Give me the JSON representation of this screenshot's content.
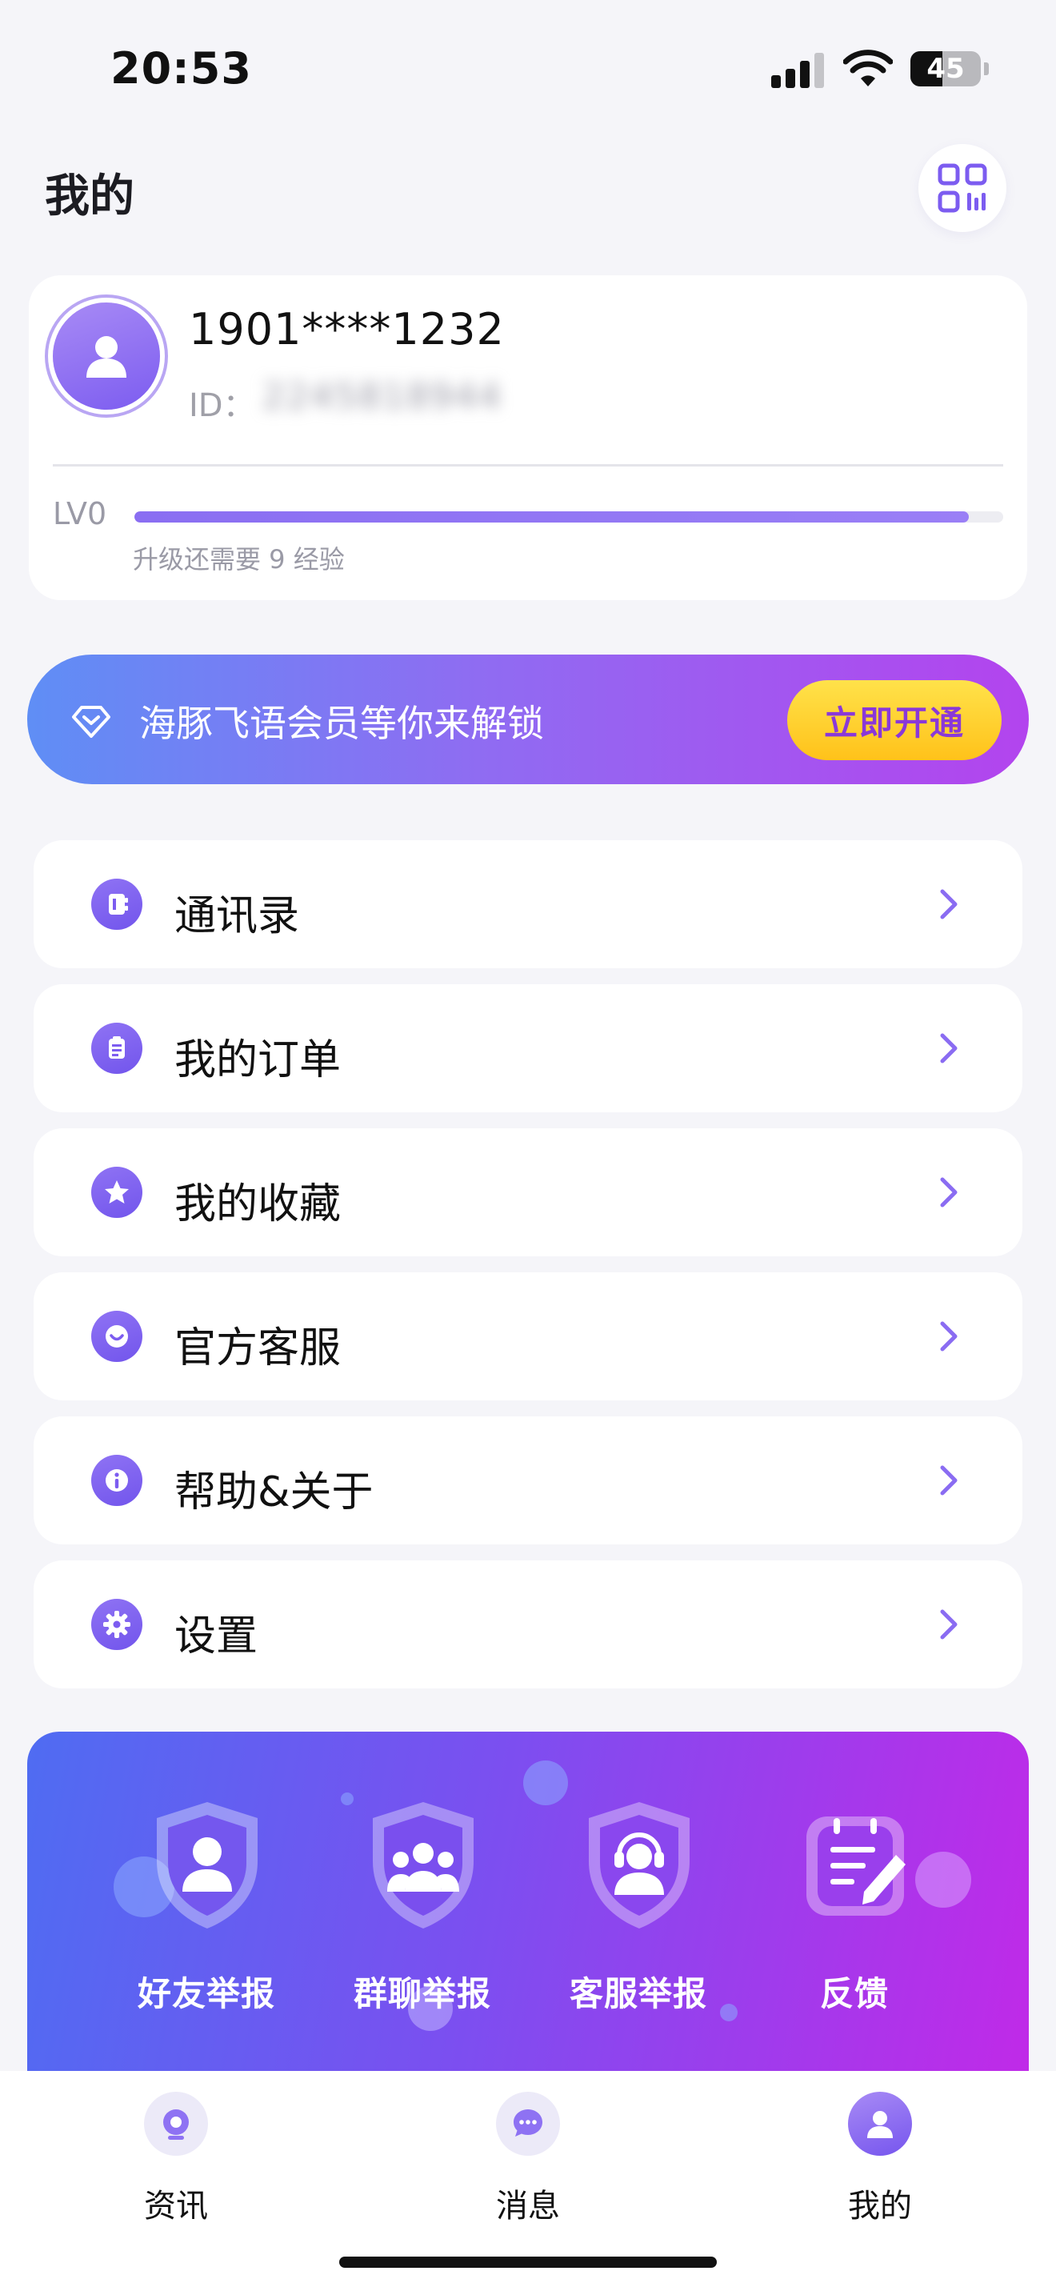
{
  "status_bar": {
    "time": "20:53",
    "battery": "45"
  },
  "header": {
    "title": "我的"
  },
  "profile": {
    "phone": "1901****1232",
    "id_label": "ID：",
    "id_value": "2245818944",
    "level": "LV0",
    "progress_percent": 96,
    "upgrade_hint": "升级还需要 9 经验"
  },
  "vip": {
    "text": "海豚飞语会员等你来解锁",
    "button": "立即开通"
  },
  "menu": {
    "items": [
      {
        "label": "通讯录",
        "icon": "contacts-icon"
      },
      {
        "label": "我的订单",
        "icon": "orders-icon"
      },
      {
        "label": "我的收藏",
        "icon": "favorites-icon"
      },
      {
        "label": "官方客服",
        "icon": "customer-service-icon"
      },
      {
        "label": "帮助&关于",
        "icon": "info-icon"
      },
      {
        "label": "设置",
        "icon": "settings-icon"
      }
    ]
  },
  "report": {
    "items": [
      {
        "label": "好友举报",
        "icon": "friend-report-icon"
      },
      {
        "label": "群聊举报",
        "icon": "group-report-icon"
      },
      {
        "label": "客服举报",
        "icon": "service-report-icon"
      },
      {
        "label": "反馈",
        "icon": "feedback-icon"
      }
    ]
  },
  "tabs": [
    {
      "label": "资讯",
      "icon": "news-icon"
    },
    {
      "label": "消息",
      "icon": "messages-icon"
    },
    {
      "label": "我的",
      "icon": "profile-icon",
      "active": true
    }
  ],
  "colors": {
    "accent": "#7c5cf0",
    "vip_button": "#ffd230",
    "chevron": "#8a6cf2"
  }
}
